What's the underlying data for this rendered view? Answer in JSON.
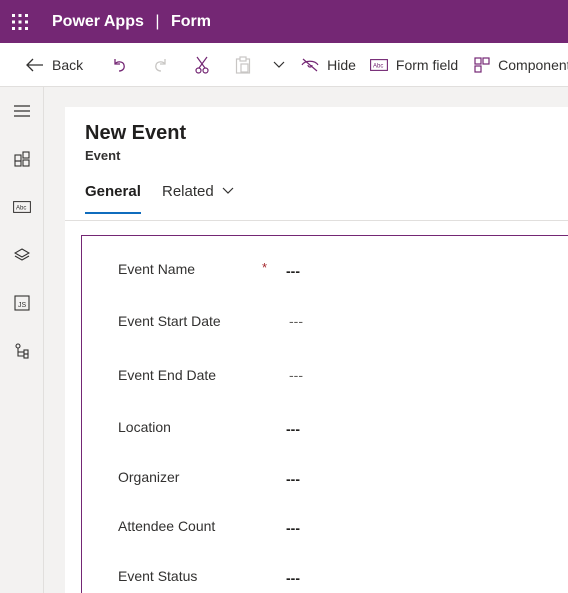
{
  "topbar": {
    "app_name": "Power Apps",
    "separator": "|",
    "page_name": "Form"
  },
  "toolbar": {
    "back_label": "Back",
    "hide_label": "Hide",
    "form_field_label": "Form field",
    "component_label": "Component"
  },
  "form": {
    "title": "New Event",
    "entity": "Event",
    "tabs": [
      {
        "label": "General",
        "selected": true
      },
      {
        "label": "Related",
        "selected": false
      }
    ],
    "fields": [
      {
        "label": "Event Name",
        "value": "---",
        "required": "*"
      },
      {
        "label": "Event Start Date",
        "value": "---"
      },
      {
        "label": "Event End Date",
        "value": "---"
      },
      {
        "label": "Location",
        "value": "---"
      },
      {
        "label": "Organizer",
        "value": "---"
      },
      {
        "label": "Attendee Count",
        "value": "---"
      },
      {
        "label": "Event Status",
        "value": "---"
      }
    ]
  },
  "colors": {
    "brand": "#742774",
    "tab_accent": "#0f6cbd",
    "required": "#a4262c"
  }
}
